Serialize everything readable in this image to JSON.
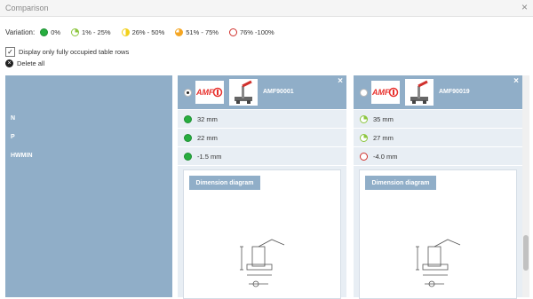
{
  "window": {
    "title": "Comparison",
    "close_glyph": "×"
  },
  "variation": {
    "label": "Variation:",
    "legend": [
      {
        "label": "0%",
        "color": "#27ae3f"
      },
      {
        "label": "1% - 25%",
        "color": "#8cc63f"
      },
      {
        "label": "26% - 50%",
        "color": "#f2d01a"
      },
      {
        "label": "51% - 75%",
        "color": "#f5a623"
      },
      {
        "label": "76% -100%",
        "color": "#d0312d"
      }
    ]
  },
  "options": {
    "fully_occupied_label": "Display only fully occupied table rows",
    "fully_occupied_checked": true
  },
  "actions": {
    "delete_all_label": "Delete all"
  },
  "rows": [
    "N",
    "P",
    "HWMIN"
  ],
  "products": [
    {
      "article": "AMF90001",
      "selected": true,
      "brand": "AMF",
      "values": [
        {
          "text": "32 mm",
          "variation": "0%"
        },
        {
          "text": "22 mm",
          "variation": "0%"
        },
        {
          "text": "-1.5 mm",
          "variation": "0%"
        }
      ],
      "diagram_label": "Dimension diagram",
      "remove_glyph": "×"
    },
    {
      "article": "AMF90019",
      "selected": false,
      "brand": "AMF",
      "values": [
        {
          "text": "35 mm",
          "variation": "1% - 25%"
        },
        {
          "text": "27 mm",
          "variation": "1% - 25%"
        },
        {
          "text": "-4.0 mm",
          "variation": "76% -100%"
        }
      ],
      "diagram_label": "Dimension diagram",
      "remove_glyph": "×"
    }
  ],
  "scrollbar": {
    "position": 0.85
  },
  "colors": {
    "header": "#90aec8",
    "cell": "#e8eef4",
    "brand": "#e8312d"
  }
}
